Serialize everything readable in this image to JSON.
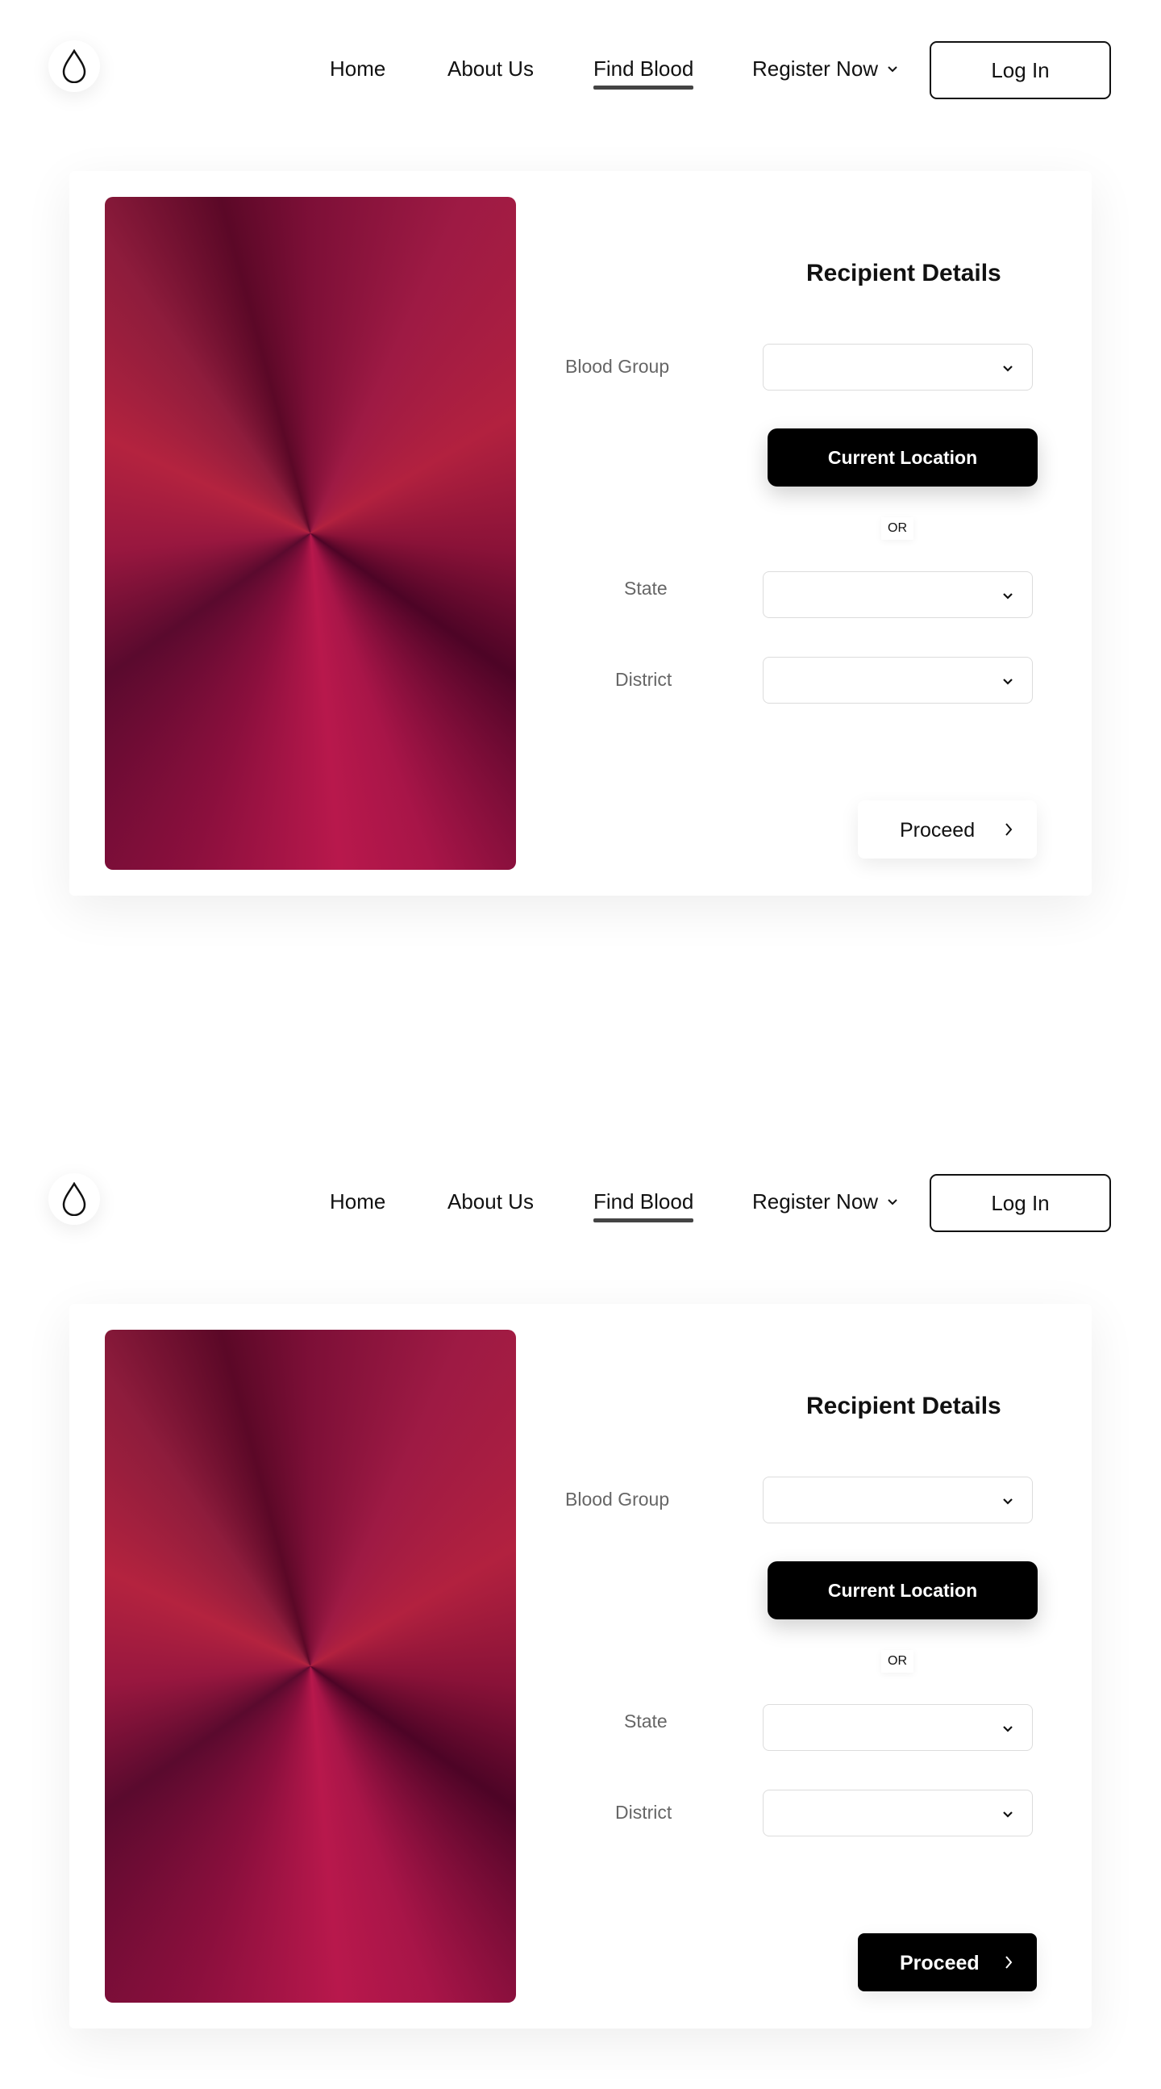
{
  "screens": [
    {
      "nav": {
        "links": [
          "Home",
          "About Us",
          "Find Blood"
        ],
        "register_label": "Register Now",
        "login_label": "Log In"
      },
      "form": {
        "title": "Recipient Details",
        "blood_group_label": "Blood Group",
        "blood_group_value": "",
        "current_location_label": "Current Location",
        "or_label": "OR",
        "state_label": "State",
        "state_value": "",
        "district_label": "District",
        "district_value": "",
        "proceed_label": "Proceed",
        "proceed_state": "default"
      }
    },
    {
      "nav": {
        "links": [
          "Home",
          "About Us",
          "Find Blood"
        ],
        "register_label": "Register Now",
        "login_label": "Log In"
      },
      "form": {
        "title": "Recipient Details",
        "blood_group_label": "Blood Group",
        "blood_group_value": "",
        "current_location_label": "Current Location",
        "or_label": "OR",
        "state_label": "State",
        "state_value": "",
        "district_label": "District",
        "district_value": "",
        "proceed_label": "Proceed",
        "proceed_state": "hover"
      }
    }
  ],
  "active_nav": "Find Blood",
  "icons": {
    "logo": "blood-drop-icon",
    "dropdown": "chevron-down-icon",
    "proceed": "chevron-right-icon"
  },
  "colors": {
    "primary_button": "#000000",
    "accent_hero": "#b2213f",
    "label_text": "#666666"
  }
}
